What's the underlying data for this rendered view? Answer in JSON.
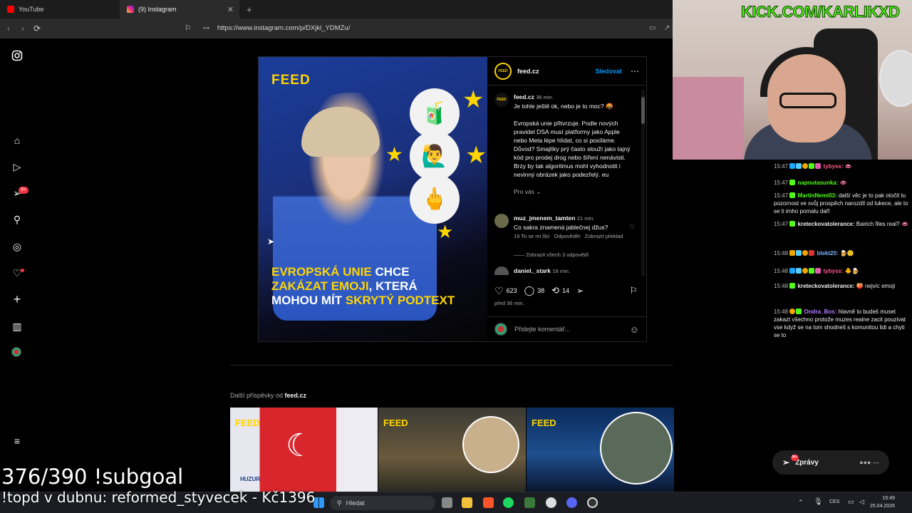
{
  "browser": {
    "tabs": [
      {
        "label": "YouTube",
        "color": "#ff0000"
      },
      {
        "label": "(9) Instagram",
        "color": "#e1306c"
      }
    ],
    "url": "https://www.instagram.com/p/DXjkl_YDMZu/"
  },
  "sidebar": {
    "notifications_badge": "9+"
  },
  "post": {
    "logo": "FEED",
    "headline_1a": "EVROPSKÁ UNIE",
    "headline_1b": " CHCE",
    "headline_2a": "ZAKÁZAT EMOJI",
    "headline_2b": ", KTERÁ",
    "headline_3a": "MOHOU MÍT ",
    "headline_3b": "SKRYTÝ PODTEXT",
    "emojis": [
      "🧃",
      "🙋‍♂️",
      "🖕"
    ],
    "author": "feed.cz",
    "follow_label": "Sledovat",
    "caption_author": "feed.cz",
    "caption_time": "36 min.",
    "caption_line1": "Je tohle ještě ok, nebo je to moc? 🤬",
    "caption_body": "Evropská unie přitvrzuje. Podle nových pravidel DSA musí platformy jako Apple nebo Meta lépe hlídat, co si posíláme. Důvod? Smajlíky prý často slouží jako tajný kód pro prodej drog nebo šíření nenávisti. Brzy by tak algoritmus mohl vyhodnotit i nevinný obrázek jako podezřelý. eu",
    "pro_vas": "Pro vás",
    "comment1_user": "muz_jmenem_tamten",
    "comment1_time": "21 min.",
    "comment1_text": "Co sakra znamená jablečnej džus?",
    "comment1_likes": "19 To se mi líbí",
    "comment1_reply": "Odpovědět",
    "comment1_translate": "Zobrazit překlad",
    "show_replies": "Zobrazit všech 3 odpovědí",
    "comment2_user": "daniel._stark",
    "comment2_time": "18 min.",
    "likes": "623",
    "comments": "38",
    "reposts": "14",
    "posted": "před 36 min.",
    "add_comment_placeholder": "Přidejte komentář..."
  },
  "more_posts": {
    "prefix": "Další příspěvky od ",
    "author": "feed.cz",
    "tile_logo": "FEED",
    "tile1_tag": "HUZUR"
  },
  "overlay": {
    "kick": "KICK.COM/KARLIKXD",
    "subgoal": "376/390 !subgoal",
    "topd": "!topd v dubnu: reformed_styvecek - Kč1396"
  },
  "chat": [
    {
      "ts": "15:47",
      "user": "tybyss:",
      "text": "",
      "color": "#ff5a8a"
    },
    {
      "ts": "15:47",
      "user": "napnutasunka:",
      "text": "",
      "color": "#53fc18"
    },
    {
      "ts": "15:47",
      "user": "MartinNemi03:",
      "text": "další věc je to pak otočit tu pozornost ve svůj prospěch narozdíl od lukece, ale to se ti imho pomalu daří",
      "color": "#53fc18"
    },
    {
      "ts": "15:47",
      "user": "kreteckovatolerance:",
      "text": "Bairich files real?",
      "color": "#eeeeee"
    },
    {
      "ts": "15:48",
      "user": "blekt20:",
      "text": "",
      "color": "#7ab0ff"
    },
    {
      "ts": "15:48",
      "user": "tybyss:",
      "text": "",
      "color": "#ff5a8a"
    },
    {
      "ts": "15:48",
      "user": "kreteckovatolerance:",
      "text": "nejvíc emoji",
      "color": "#eeeeee"
    },
    {
      "ts": "15:48",
      "user": "Ondra_Bos:",
      "text": "hlavně to budeš muset zakazt všechno protože muzes realne zacit pouzivat vse když se na tom shodneš s komunitou lidi a chyti se to",
      "color": "#b07cff"
    }
  ],
  "messages_label": "Zprávy",
  "messages_badge": "9+",
  "taskbar": {
    "search_placeholder": "Hledat",
    "lang": "CES",
    "time": "15:49",
    "date": "25.04.2026"
  }
}
